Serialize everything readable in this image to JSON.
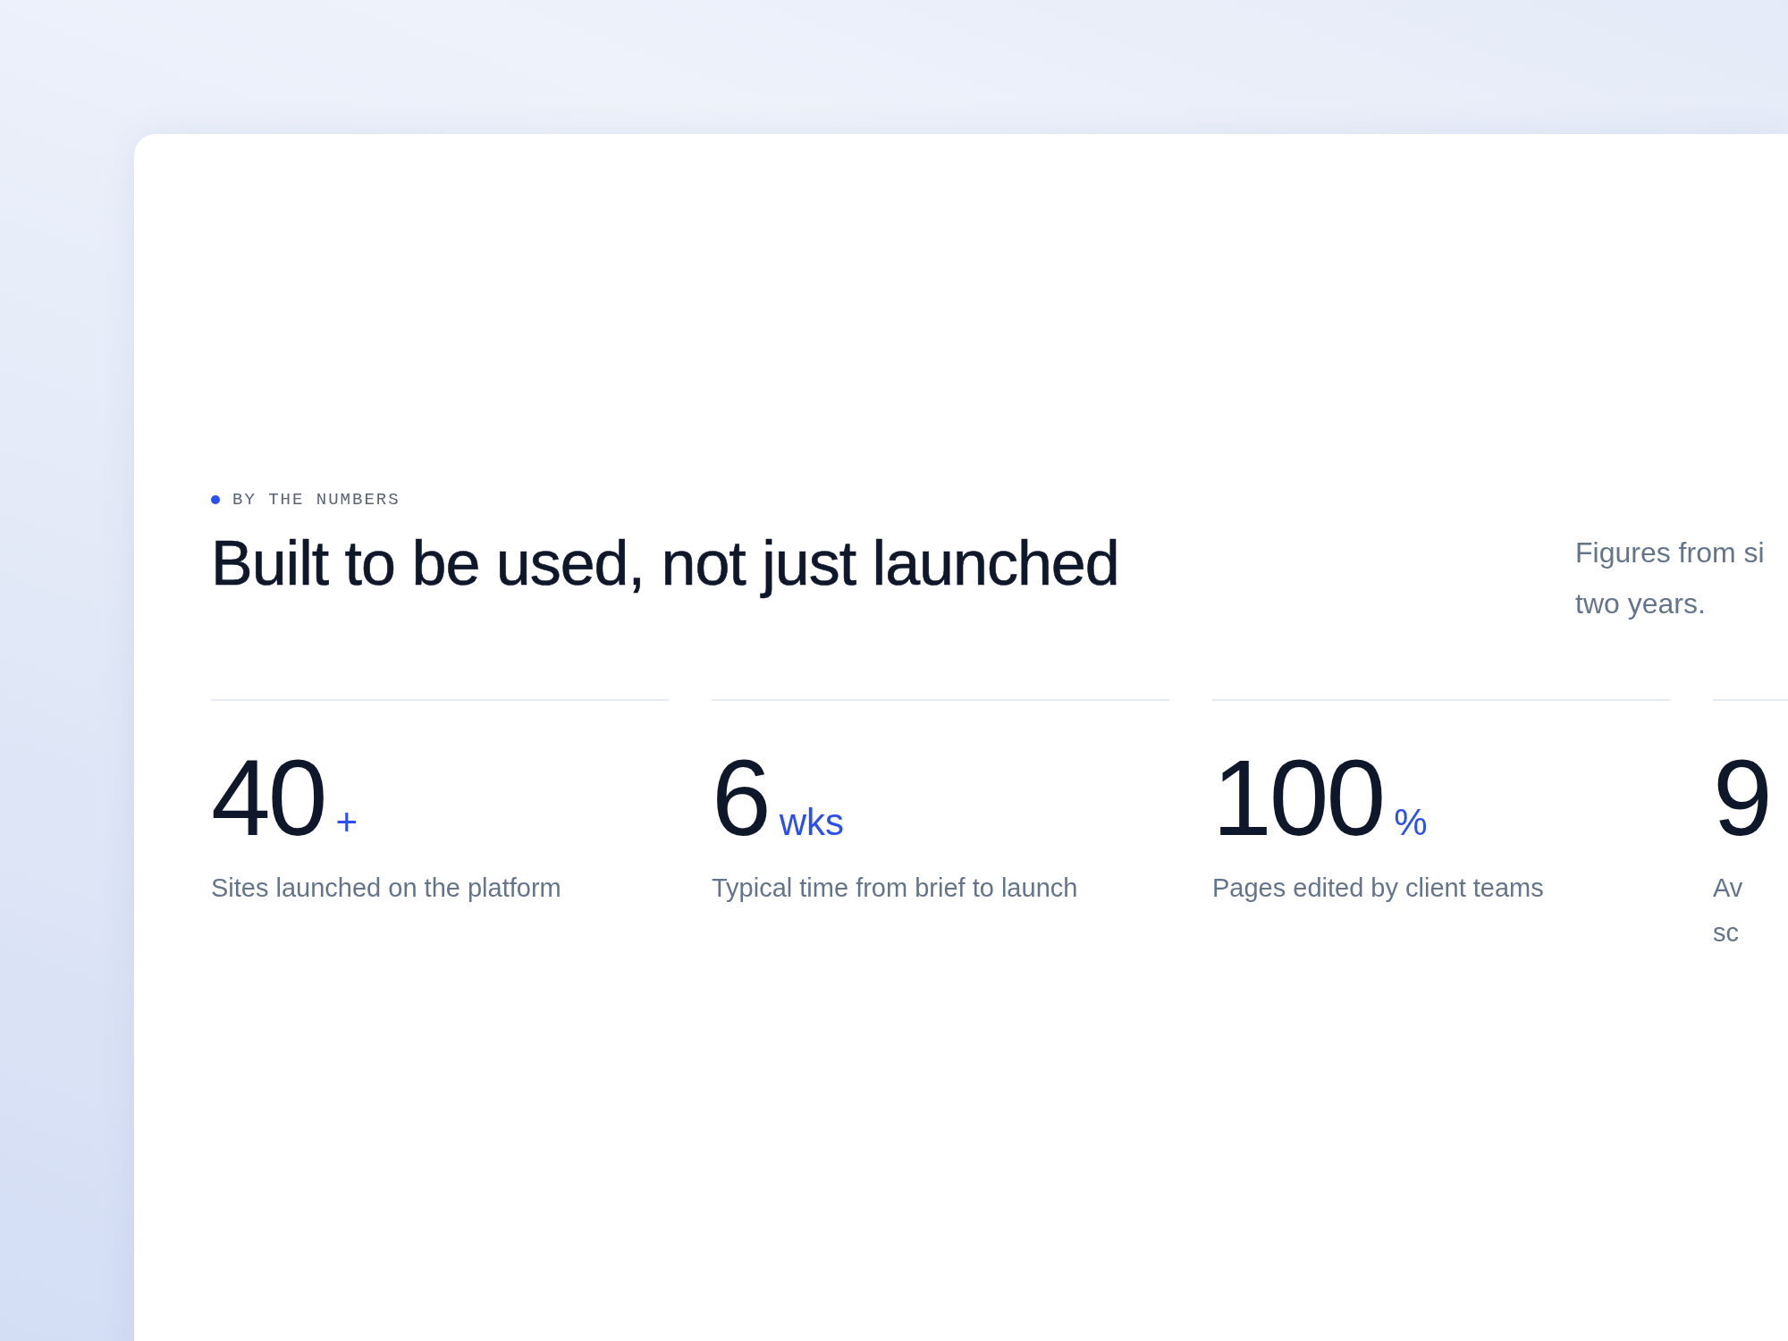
{
  "section": {
    "eyebrow": "BY THE NUMBERS",
    "heading": "Built to be used, not just launched",
    "intro": "Figures from si\ntwo years."
  },
  "stats": [
    {
      "value": "40",
      "suffix": "+",
      "label": "Sites launched on the platform"
    },
    {
      "value": "6",
      "suffix": "wks",
      "label": "Typical time from brief to launch"
    },
    {
      "value": "100",
      "suffix": "%",
      "label": "Pages edited by client teams"
    },
    {
      "value": "9",
      "label": "Av\nsc"
    }
  ]
}
